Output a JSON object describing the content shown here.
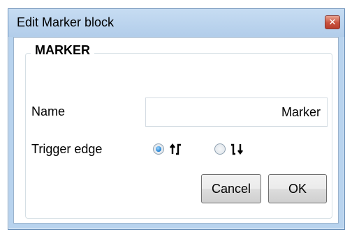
{
  "window": {
    "title": "Edit Marker block"
  },
  "icons": {
    "close": "close-icon",
    "rising_edge": "rising-edge-icon",
    "falling_edge": "falling-edge-icon"
  },
  "group": {
    "title": "MARKER"
  },
  "fields": {
    "name_label": "Name",
    "name_value": "Marker",
    "trigger_edge_label": "Trigger edge",
    "trigger_edge_selected": "rising"
  },
  "buttons": {
    "cancel": "Cancel",
    "ok": "OK"
  },
  "colors": {
    "title_bar": "#b8d3ee",
    "radio_selected": "#1f7fd1",
    "close_button": "#c8523e"
  }
}
